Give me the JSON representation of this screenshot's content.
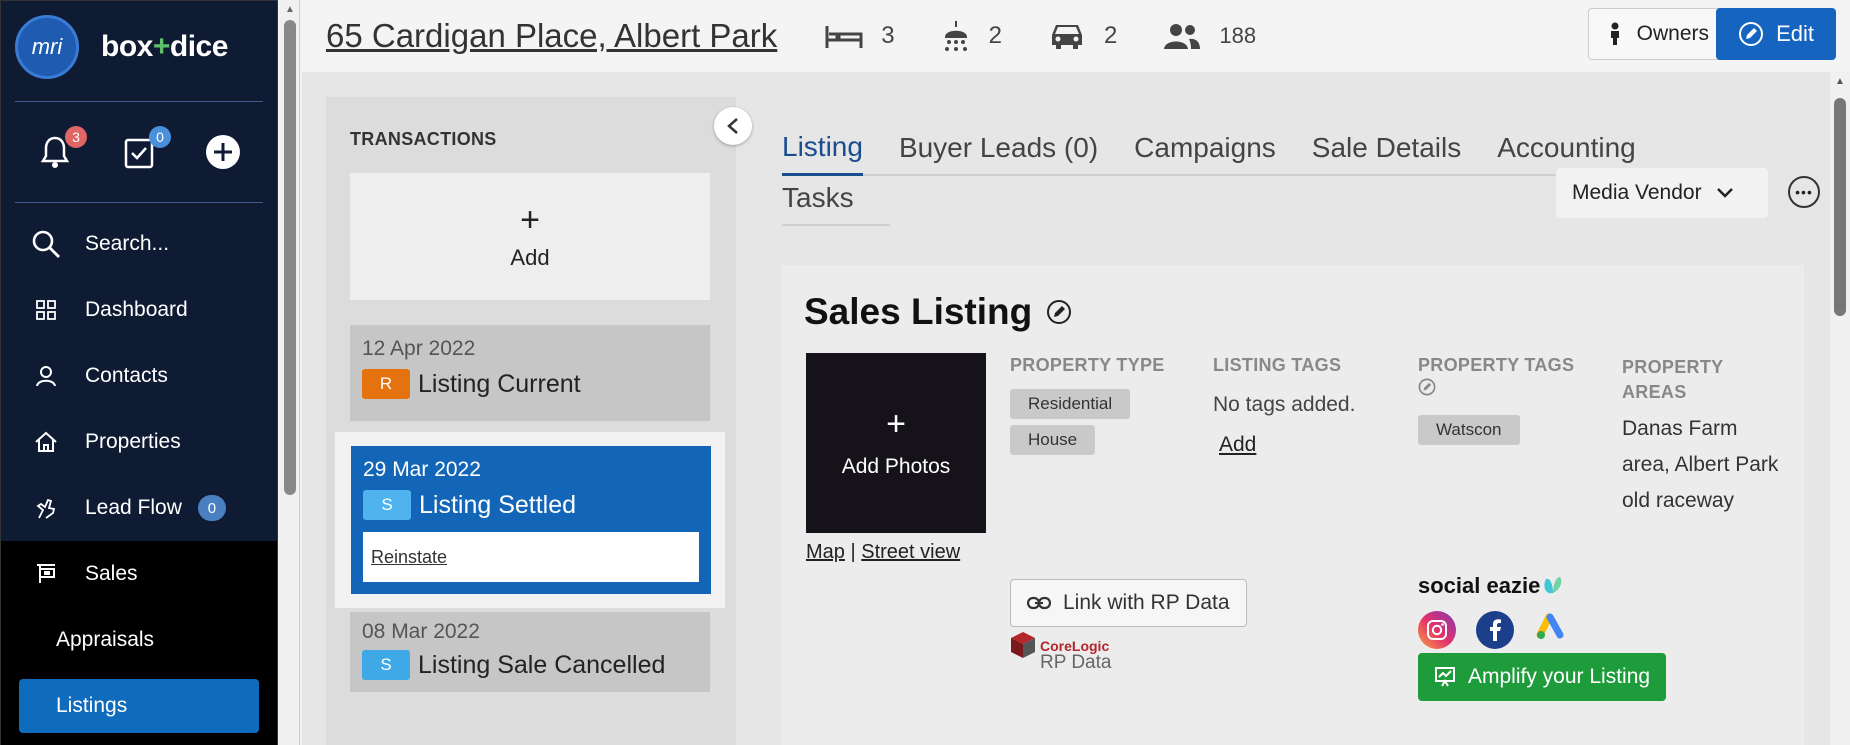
{
  "sidebar": {
    "logo_text": "mri",
    "brand_left": "box",
    "brand_plus": "+",
    "brand_right": "dice",
    "notifications_count": "3",
    "tasks_count": "0",
    "items": [
      {
        "label": "Search..."
      },
      {
        "label": "Dashboard"
      },
      {
        "label": "Contacts"
      },
      {
        "label": "Properties"
      },
      {
        "label": "Lead Flow",
        "badge": "0"
      },
      {
        "label": "Sales"
      },
      {
        "label": "Appraisals"
      },
      {
        "label": "Listings"
      }
    ]
  },
  "header": {
    "address": "65 Cardigan Place, Albert Park",
    "beds": "3",
    "baths": "2",
    "cars": "2",
    "people": "188",
    "owners_label": "Owners",
    "edit_label": "Edit"
  },
  "transactions": {
    "title": "TRANSACTIONS",
    "add_label": "Add",
    "cards": [
      {
        "date": "12 Apr 2022",
        "badge": "R",
        "status": "Listing Current",
        "badge_color": "#e3720f"
      },
      {
        "date": "29 Mar 2022",
        "badge": "S",
        "status": "Listing Settled",
        "badge_color": "#4fb3ee",
        "action": "Reinstate"
      },
      {
        "date": "08 Mar 2022",
        "badge": "S",
        "status": "Listing Sale Cancelled",
        "badge_color": "#3ea9e6"
      }
    ]
  },
  "tabs": [
    "Listing",
    "Buyer Leads (0)",
    "Campaigns",
    "Sale Details",
    "Accounting",
    "Tasks"
  ],
  "media_vendor": "Media Vendor",
  "sales_listing": {
    "title": "Sales Listing",
    "add_photos": "Add Photos",
    "map_link": "Map",
    "separator": "|",
    "street_view_link": "Street view",
    "property_type_heading": "PROPERTY TYPE",
    "property_types": [
      "Residential",
      "House"
    ],
    "listing_tags_heading": "LISTING TAGS",
    "no_tags": "No tags added.",
    "add_tag": "Add",
    "property_tags_heading": "PROPERTY TAGS",
    "property_tags": [
      "Watscon"
    ],
    "property_areas_heading": "PROPERTY AREAS",
    "property_areas": "Danas Farm area, Albert Park old raceway",
    "rp_button": "Link with RP Data",
    "corelogic_name": "CoreLogic",
    "corelogic_sub": "RP Data",
    "social_eazie": "social eazie",
    "amplify_button": "Amplify your Listing"
  },
  "colors": {
    "sidebar_bg": "#0e1b33",
    "accent_blue": "#1565c0",
    "selected_card": "#1366b7",
    "amplify_green": "#1e9b3a"
  }
}
